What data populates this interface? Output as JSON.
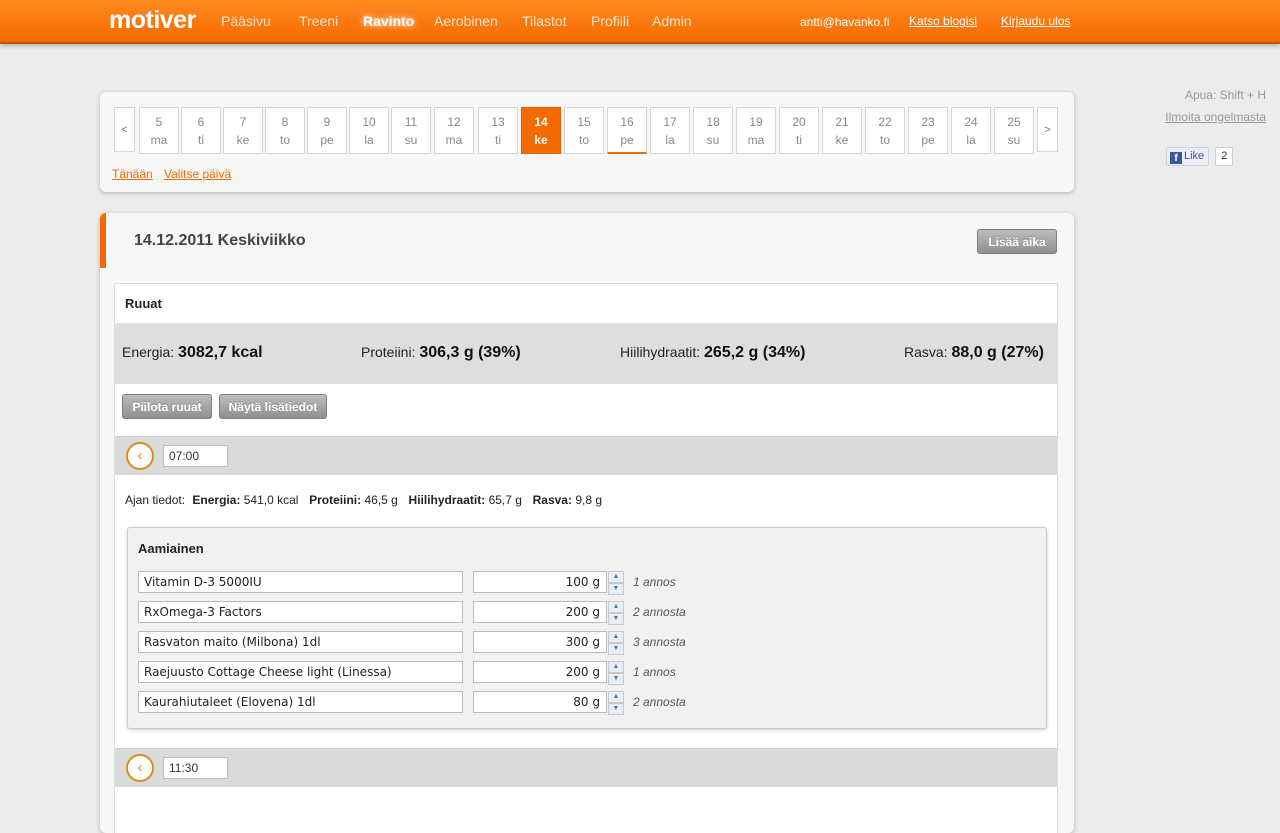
{
  "app": {
    "logo": "motiver",
    "nav": [
      "Pääsivu",
      "Treeni",
      "Ravinto",
      "Aerobinen",
      "Tilastot",
      "Profiili",
      "Admin"
    ],
    "active_nav": "Ravinto",
    "user_email": "antti@havanko.fi",
    "blog_link": "Katso blogisi",
    "logout_link": "Kirjaudu ulos"
  },
  "side": {
    "help": "Apua: Shift + H",
    "report": "Ilmoita ongelmasta",
    "like_label": "Like",
    "like_count": "2"
  },
  "calendar": {
    "prev": "<",
    "next": ">",
    "days": [
      {
        "n": "5",
        "w": "ma"
      },
      {
        "n": "6",
        "w": "ti"
      },
      {
        "n": "7",
        "w": "ke"
      },
      {
        "n": "8",
        "w": "to"
      },
      {
        "n": "9",
        "w": "pe"
      },
      {
        "n": "10",
        "w": "la"
      },
      {
        "n": "11",
        "w": "su"
      },
      {
        "n": "12",
        "w": "ma"
      },
      {
        "n": "13",
        "w": "ti"
      },
      {
        "n": "14",
        "w": "ke"
      },
      {
        "n": "15",
        "w": "to"
      },
      {
        "n": "16",
        "w": "pe"
      },
      {
        "n": "17",
        "w": "la"
      },
      {
        "n": "18",
        "w": "su"
      },
      {
        "n": "19",
        "w": "ma"
      },
      {
        "n": "20",
        "w": "ti"
      },
      {
        "n": "21",
        "w": "ke"
      },
      {
        "n": "22",
        "w": "to"
      },
      {
        "n": "23",
        "w": "pe"
      },
      {
        "n": "24",
        "w": "la"
      },
      {
        "n": "25",
        "w": "su"
      }
    ],
    "selected_day": "14",
    "today_day": "16",
    "today_link": "Tänään",
    "pick_link": "Valitse päivä"
  },
  "day": {
    "title": "14.12.2011 Keskiviikko",
    "add_time_button": "Lisää aika",
    "section_title": "Ruuat",
    "totals": {
      "energy_label": "Energia:",
      "energy_value": "3082,7 kcal",
      "protein_label": "Proteiini:",
      "protein_value": "306,3 g (39%)",
      "carbs_label": "Hiilihydraatit:",
      "carbs_value": "265,2 g (34%)",
      "fat_label": "Rasva:",
      "fat_value": "88,0 g (27%)"
    },
    "hide_foods_button": "Piilota ruuat",
    "show_details_button": "Näytä lisätiedot"
  },
  "times": [
    {
      "time": "07:00",
      "info_label": "Ajan tiedot:",
      "energy_label": "Energia:",
      "energy_value": "541,0 kcal",
      "protein_label": "Proteiini:",
      "protein_value": "46,5 g",
      "carbs_label": "Hiilihydraatit:",
      "carbs_value": "65,7 g",
      "fat_label": "Rasva:",
      "fat_value": "9,8 g",
      "meal_title": "Aamiainen",
      "foods": [
        {
          "name": "Vitamin D-3 5000IU",
          "amount": "100 g",
          "portion": "1 annos"
        },
        {
          "name": "RxOmega-3 Factors",
          "amount": "200 g",
          "portion": "2 annosta"
        },
        {
          "name": "Rasvaton maito (Milbona) 1dl",
          "amount": "300 g",
          "portion": "3 annosta"
        },
        {
          "name": "Raejuusto Cottage Cheese light (Linessa)",
          "amount": "200 g",
          "portion": "1 annos"
        },
        {
          "name": "Kaurahiutaleet (Elovena) 1dl",
          "amount": "80 g",
          "portion": "2 annosta"
        }
      ]
    },
    {
      "time": "11:30"
    }
  ],
  "colors": {
    "accent": "#f56a00",
    "clock": "#d58f1c"
  }
}
